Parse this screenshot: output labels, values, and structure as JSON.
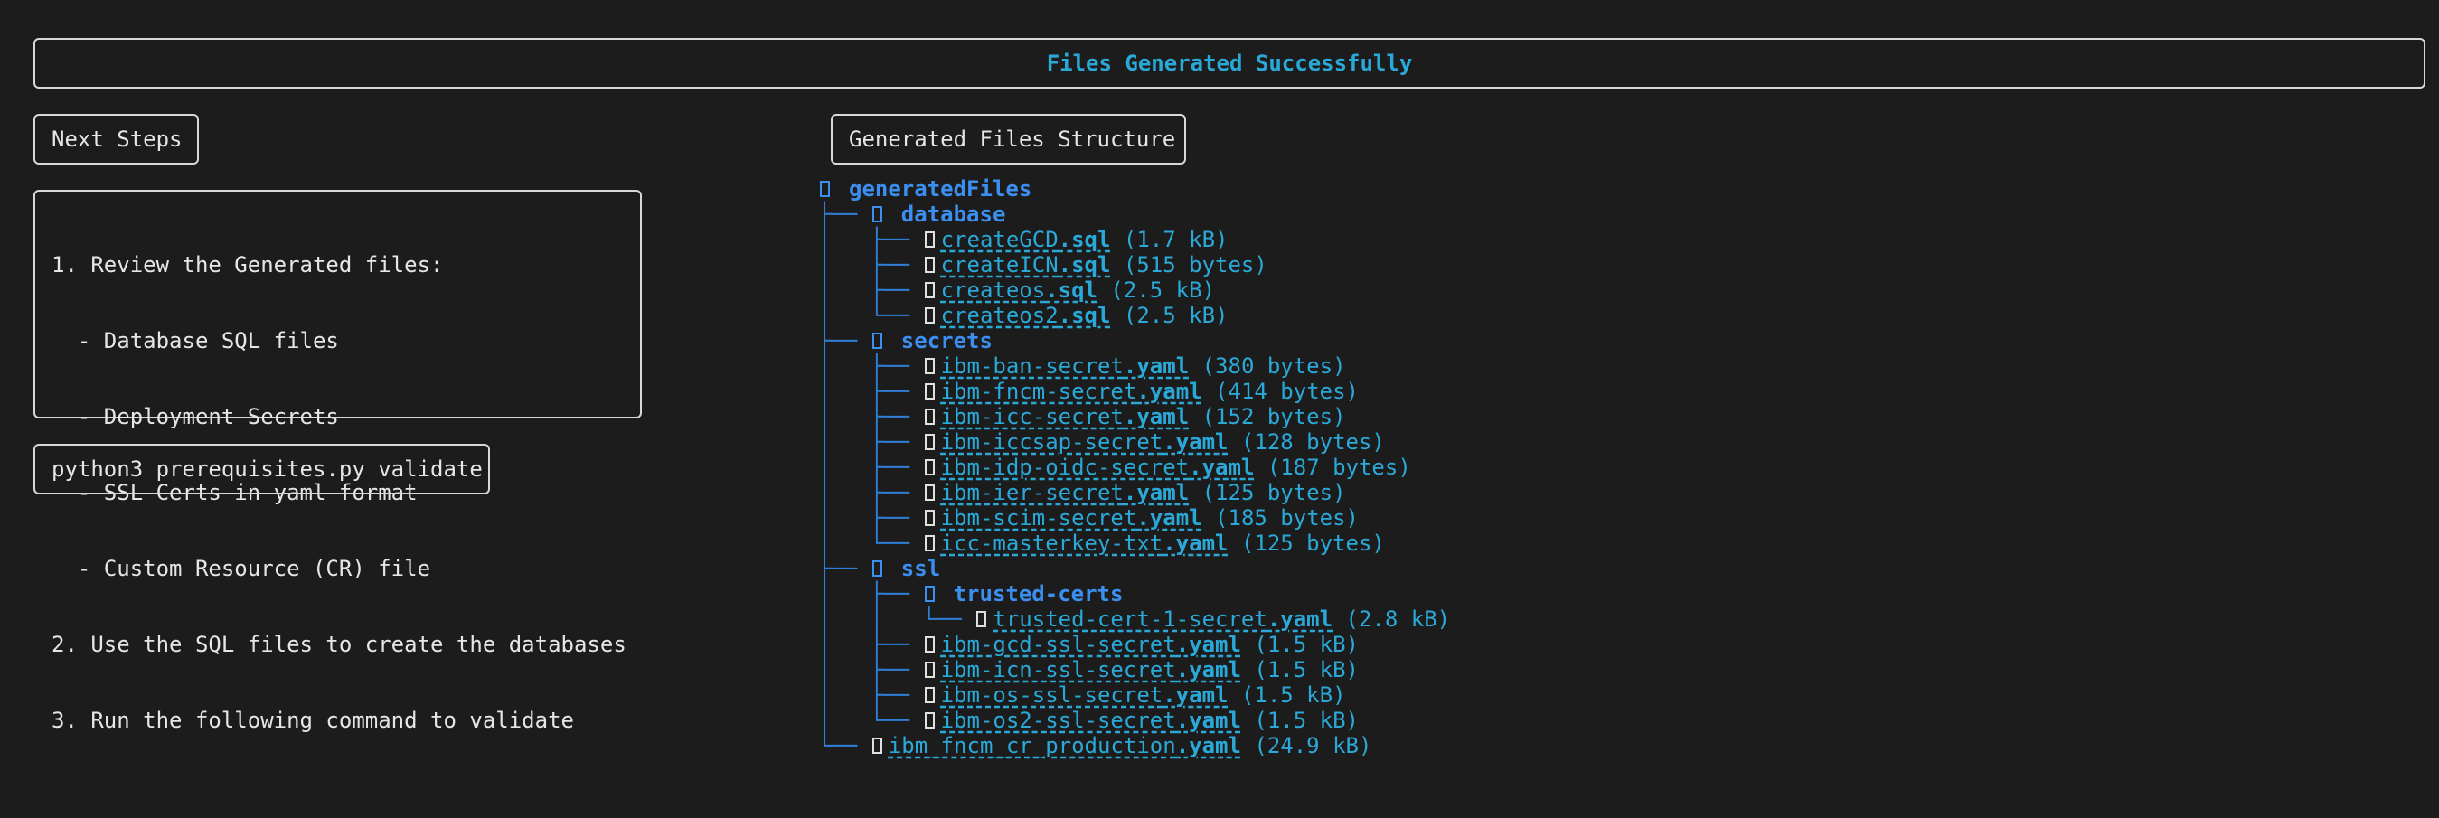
{
  "header": {
    "title": "Files Generated Successfully"
  },
  "next_steps": {
    "label": "Next Steps",
    "items": [
      "1. Review the Generated files:",
      "  - Database SQL files",
      "  - Deployment Secrets",
      "  - SSL Certs in yaml format",
      "  - Custom Resource (CR) file",
      "2. Use the SQL files to create the databases",
      "3. Run the following command to validate"
    ]
  },
  "command": {
    "text": "python3 prerequisites.py validate"
  },
  "tree": {
    "label": "Generated Files Structure",
    "root": "generatedFiles",
    "rows": [
      {
        "prefix": "",
        "type": "root",
        "name": "generatedFiles"
      },
      {
        "prefix": "├── ",
        "type": "dir",
        "name": "database"
      },
      {
        "prefix": "│   ├── ",
        "type": "file",
        "base": "createGCD",
        "ext": ".sql",
        "size": "(1.7 kB)"
      },
      {
        "prefix": "│   ├── ",
        "type": "file",
        "base": "createICN",
        "ext": ".sql",
        "size": "(515 bytes)"
      },
      {
        "prefix": "│   ├── ",
        "type": "file",
        "base": "createos",
        "ext": ".sql",
        "size": "(2.5 kB)"
      },
      {
        "prefix": "│   └── ",
        "type": "file",
        "base": "createos2",
        "ext": ".sql",
        "size": "(2.5 kB)"
      },
      {
        "prefix": "├── ",
        "type": "dir",
        "name": "secrets"
      },
      {
        "prefix": "│   ├── ",
        "type": "file",
        "base": "ibm-ban-secret",
        "ext": ".yaml",
        "size": "(380 bytes)"
      },
      {
        "prefix": "│   ├── ",
        "type": "file",
        "base": "ibm-fncm-secret",
        "ext": ".yaml",
        "size": "(414 bytes)"
      },
      {
        "prefix": "│   ├── ",
        "type": "file",
        "base": "ibm-icc-secret",
        "ext": ".yaml",
        "size": "(152 bytes)"
      },
      {
        "prefix": "│   ├── ",
        "type": "file",
        "base": "ibm-iccsap-secret",
        "ext": ".yaml",
        "size": "(128 bytes)"
      },
      {
        "prefix": "│   ├── ",
        "type": "file",
        "base": "ibm-idp-oidc-secret",
        "ext": ".yaml",
        "size": "(187 bytes)"
      },
      {
        "prefix": "│   ├── ",
        "type": "file",
        "base": "ibm-ier-secret",
        "ext": ".yaml",
        "size": "(125 bytes)"
      },
      {
        "prefix": "│   ├── ",
        "type": "file",
        "base": "ibm-scim-secret",
        "ext": ".yaml",
        "size": "(185 bytes)"
      },
      {
        "prefix": "│   └── ",
        "type": "file",
        "base": "icc-masterkey-txt",
        "ext": ".yaml",
        "size": "(125 bytes)"
      },
      {
        "prefix": "├── ",
        "type": "dir",
        "name": "ssl"
      },
      {
        "prefix": "│   ├── ",
        "type": "dir",
        "name": "trusted-certs"
      },
      {
        "prefix": "│   │   └── ",
        "type": "file",
        "base": "trusted-cert-1-secret",
        "ext": ".yaml",
        "size": "(2.8 kB)"
      },
      {
        "prefix": "│   ├── ",
        "type": "file",
        "base": "ibm-gcd-ssl-secret",
        "ext": ".yaml",
        "size": "(1.5 kB)"
      },
      {
        "prefix": "│   ├── ",
        "type": "file",
        "base": "ibm-icn-ssl-secret",
        "ext": ".yaml",
        "size": "(1.5 kB)"
      },
      {
        "prefix": "│   ├── ",
        "type": "file",
        "base": "ibm-os-ssl-secret",
        "ext": ".yaml",
        "size": "(1.5 kB)"
      },
      {
        "prefix": "│   └── ",
        "type": "file",
        "base": "ibm-os2-ssl-secret",
        "ext": ".yaml",
        "size": "(1.5 kB)"
      },
      {
        "prefix": "└── ",
        "type": "file",
        "base": "ibm_fncm_cr_production",
        "ext": ".yaml",
        "size": "(24.9 kB)"
      }
    ]
  },
  "colors": {
    "background": "#1c1c1c",
    "accent": "#2aa9d9",
    "directory": "#3b8ff0",
    "border": "#d8d8d8"
  }
}
